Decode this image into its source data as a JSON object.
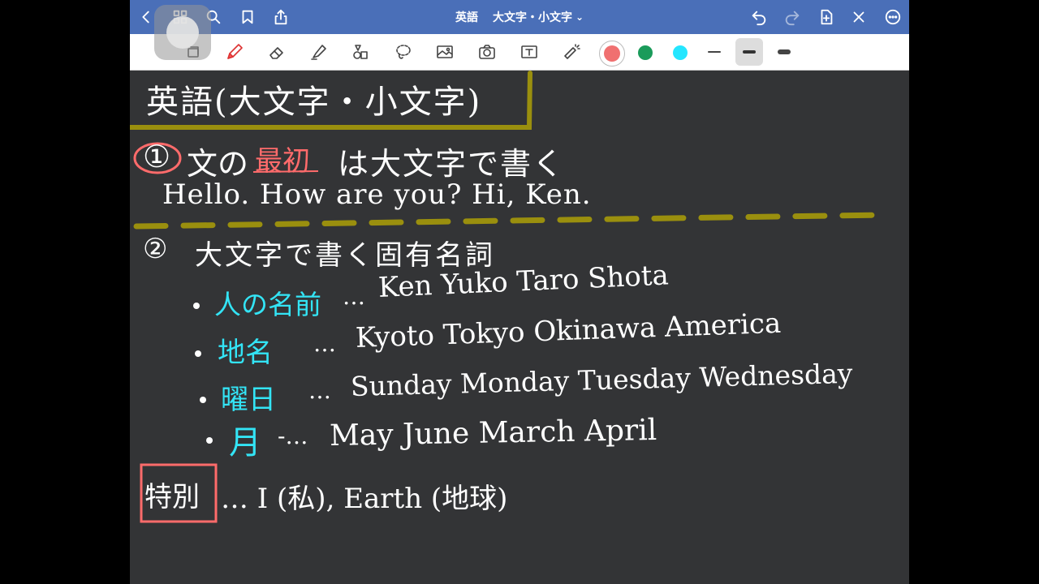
{
  "navbar": {
    "title_subject": "英語",
    "title_topic": "大文字・小文字",
    "title_chevron": "⌄"
  },
  "toolbar": {
    "tools": [
      "page-icon",
      "pen-icon",
      "eraser-icon",
      "highlighter-icon",
      "shapes-icon",
      "lasso-icon",
      "image-icon",
      "camera-icon",
      "text-icon",
      "laser-icon"
    ],
    "colors": [
      "#f07070",
      "#1a9b5a",
      "#24e6ff"
    ],
    "selected_stroke": "medium"
  },
  "note": {
    "heading": "英語(大文字・小文字)",
    "rule1": {
      "number": "①",
      "prefix": "文の",
      "keyword": "最初",
      "suffix": "は大文字で書く",
      "example": "Hello. How are you?  Hi, Ken."
    },
    "rule2": {
      "number": "②",
      "text": "大文字で書く固有名詞",
      "items": [
        {
          "label": "人の名前",
          "sep": "…",
          "words": "Ken  Yuko  Taro  Shota"
        },
        {
          "label": "地名",
          "sep": "…",
          "words": "Kyoto  Tokyo  Okinawa  America"
        },
        {
          "label": "曜日",
          "sep": "…",
          "words": "Sunday  Monday  Tuesday  Wednesday"
        },
        {
          "label": "月",
          "sep": "-…",
          "words": "May  June  March  April"
        }
      ]
    },
    "special": {
      "label": "特別",
      "text": "… I (私), Earth (地球)"
    }
  },
  "colors": {
    "nav": "#4a6fb8",
    "canvas": "#333436",
    "olive": "#9a8f0e",
    "cyan": "#33e4f5",
    "red": "#ff6b6b"
  }
}
